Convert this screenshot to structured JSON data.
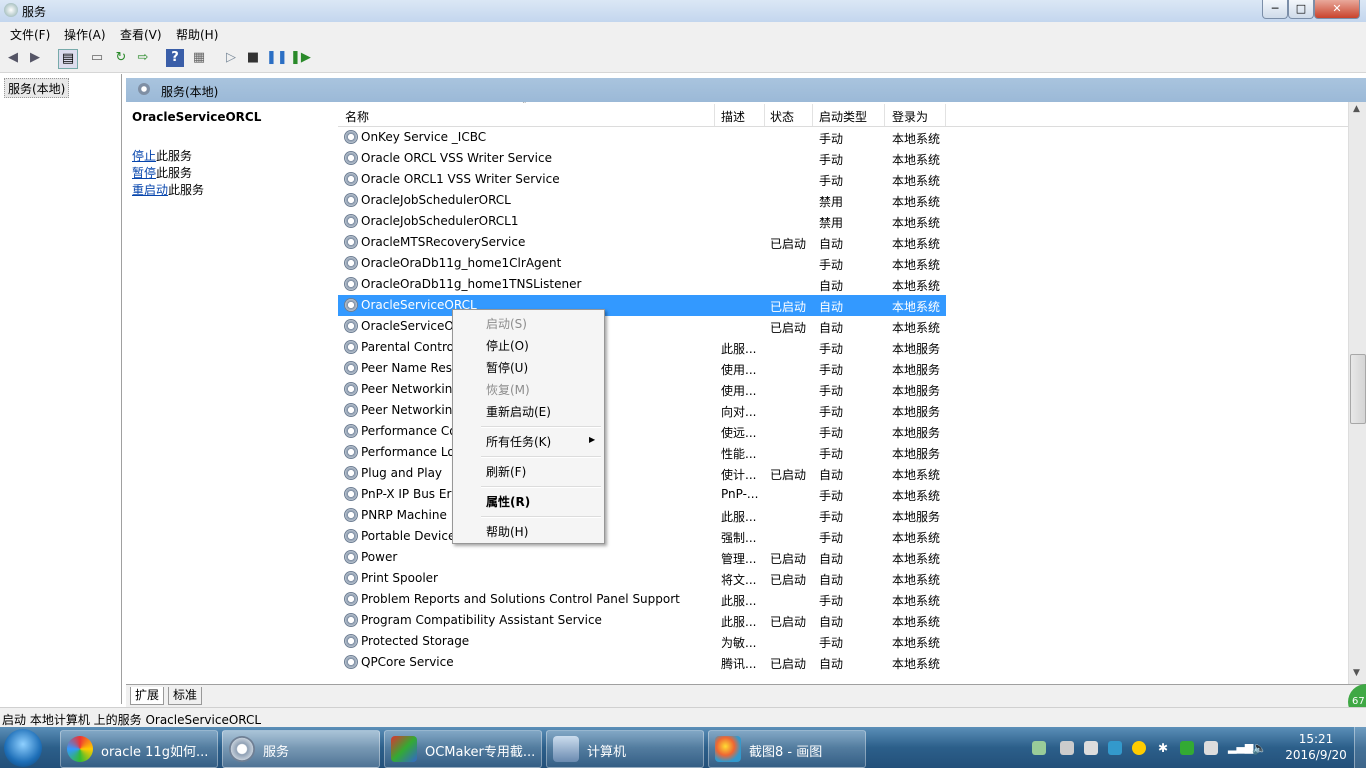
{
  "window": {
    "title": "服务",
    "min_label": "─",
    "max_label": "□",
    "close_label": "✕"
  },
  "menubar": {
    "items": [
      "文件(F)",
      "操作(A)",
      "查看(V)",
      "帮助(H)"
    ]
  },
  "tree": {
    "root_label": "服务(本地)"
  },
  "right_header": {
    "title": "服务(本地)"
  },
  "description": {
    "service_name": "OracleServiceORCL",
    "links": [
      {
        "link": "停止",
        "rest": "此服务"
      },
      {
        "link": "暂停",
        "rest": "此服务"
      },
      {
        "link": "重启动",
        "rest": "此服务"
      }
    ]
  },
  "list": {
    "columns": [
      "名称",
      "描述",
      "状态",
      "启动类型",
      "登录为"
    ],
    "rows": [
      {
        "name": "OnKey Service _ICBC",
        "desc": "",
        "status": "",
        "type": "手动",
        "logon": "本地系统"
      },
      {
        "name": "Oracle ORCL VSS Writer Service",
        "desc": "",
        "status": "",
        "type": "手动",
        "logon": "本地系统"
      },
      {
        "name": "Oracle ORCL1 VSS Writer Service",
        "desc": "",
        "status": "",
        "type": "手动",
        "logon": "本地系统"
      },
      {
        "name": "OracleJobSchedulerORCL",
        "desc": "",
        "status": "",
        "type": "禁用",
        "logon": "本地系统"
      },
      {
        "name": "OracleJobSchedulerORCL1",
        "desc": "",
        "status": "",
        "type": "禁用",
        "logon": "本地系统"
      },
      {
        "name": "OracleMTSRecoveryService",
        "desc": "",
        "status": "已启动",
        "type": "自动",
        "logon": "本地系统"
      },
      {
        "name": "OracleOraDb11g_home1ClrAgent",
        "desc": "",
        "status": "",
        "type": "手动",
        "logon": "本地系统"
      },
      {
        "name": "OracleOraDb11g_home1TNSListener",
        "desc": "",
        "status": "",
        "type": "自动",
        "logon": "本地系统"
      },
      {
        "name": "OracleServiceORCL",
        "desc": "",
        "status": "已启动",
        "type": "自动",
        "logon": "本地系统",
        "selected": true
      },
      {
        "name": "OracleServiceO",
        "desc": "",
        "status": "已启动",
        "type": "自动",
        "logon": "本地系统"
      },
      {
        "name": "Parental Contro",
        "desc": "此服...",
        "status": "",
        "type": "手动",
        "logon": "本地服务"
      },
      {
        "name": "Peer Name Res",
        "desc": "使用...",
        "status": "",
        "type": "手动",
        "logon": "本地服务"
      },
      {
        "name": "Peer Networkin",
        "desc": "使用...",
        "status": "",
        "type": "手动",
        "logon": "本地服务"
      },
      {
        "name": "Peer Networkin",
        "desc": "向对...",
        "status": "",
        "type": "手动",
        "logon": "本地服务"
      },
      {
        "name": "Performance Co",
        "desc": "使远...",
        "status": "",
        "type": "手动",
        "logon": "本地服务"
      },
      {
        "name": "Performance Lo",
        "desc": "性能...",
        "status": "",
        "type": "手动",
        "logon": "本地服务"
      },
      {
        "name": "Plug and Play",
        "desc": "使计...",
        "status": "已启动",
        "type": "自动",
        "logon": "本地系统"
      },
      {
        "name": "PnP-X IP Bus Er",
        "desc": "PnP-...",
        "status": "",
        "type": "手动",
        "logon": "本地系统"
      },
      {
        "name": "PNRP Machine",
        "desc": "此服...",
        "status": "",
        "type": "手动",
        "logon": "本地服务"
      },
      {
        "name": "Portable Device",
        "desc": "强制...",
        "status": "",
        "type": "手动",
        "logon": "本地系统"
      },
      {
        "name": "Power",
        "desc": "管理...",
        "status": "已启动",
        "type": "自动",
        "logon": "本地系统"
      },
      {
        "name": "Print Spooler",
        "desc": "将文...",
        "status": "已启动",
        "type": "自动",
        "logon": "本地系统"
      },
      {
        "name": "Problem Reports and Solutions Control Panel Support",
        "desc": "此服...",
        "status": "",
        "type": "手动",
        "logon": "本地系统"
      },
      {
        "name": "Program Compatibility Assistant Service",
        "desc": "此服...",
        "status": "已启动",
        "type": "自动",
        "logon": "本地系统"
      },
      {
        "name": "Protected Storage",
        "desc": "为敏...",
        "status": "",
        "type": "手动",
        "logon": "本地系统"
      },
      {
        "name": "QPCore Service",
        "desc": "腾讯...",
        "status": "已启动",
        "type": "自动",
        "logon": "本地系统"
      }
    ]
  },
  "context_menu": {
    "items": [
      {
        "label": "启动(S)",
        "disabled": true
      },
      {
        "label": "停止(O)",
        "disabled": false
      },
      {
        "label": "暂停(U)",
        "disabled": false
      },
      {
        "label": "恢复(M)",
        "disabled": true
      },
      {
        "label": "重新启动(E)",
        "disabled": false
      },
      {
        "label": "所有任务(K)",
        "disabled": false,
        "submenu": true
      },
      {
        "label": "刷新(F)",
        "disabled": false
      },
      {
        "label": "属性(R)",
        "disabled": false,
        "bold": true
      },
      {
        "label": "帮助(H)",
        "disabled": false
      }
    ]
  },
  "tabs": [
    "扩展",
    "标准"
  ],
  "status_bar": "启动 本地计算机 上的服务 OracleServiceORCL",
  "taskbar": {
    "items": [
      "oracle 11g如何...",
      "服务",
      "OCMaker专用截...",
      "计算机",
      "截图8 - 画图"
    ],
    "time": "15:21",
    "date": "2016/9/20",
    "badge": "67"
  }
}
